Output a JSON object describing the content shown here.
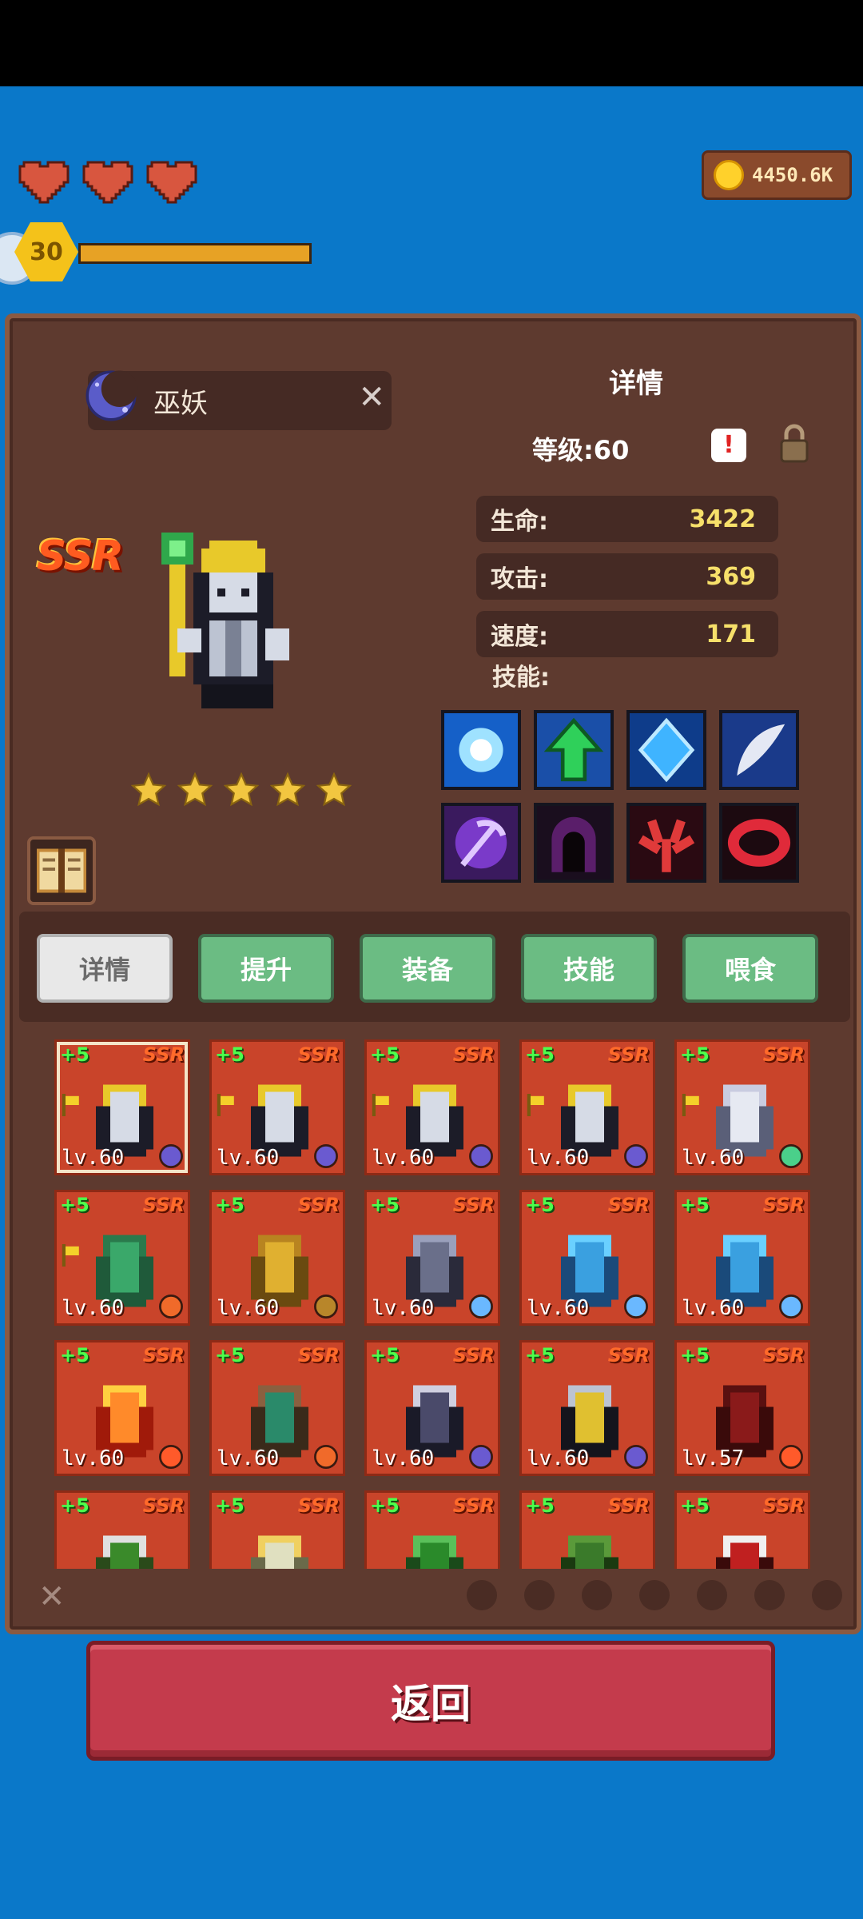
{
  "hud": {
    "hearts": 3,
    "player_level": "30",
    "xp_fraction": 1.0,
    "coins": "4450.6K"
  },
  "hero": {
    "name": "巫妖",
    "rarity": "SSR",
    "stars": 5,
    "detail_title": "详情",
    "level_label": "等级:60",
    "stats": [
      {
        "label": "生命:",
        "value": "3422"
      },
      {
        "label": "攻击:",
        "value": "369"
      },
      {
        "label": "速度:",
        "value": "171"
      }
    ],
    "skills_label": "技能:",
    "skills": [
      "light-orb-skill-icon",
      "green-arrow-up-skill-icon",
      "blue-crystal-skill-icon",
      "feather-skill-icon",
      "purple-scythe-skill-icon",
      "dark-hood-skill-icon",
      "red-claw-skill-icon",
      "red-ring-skill-icon"
    ]
  },
  "tabs": [
    {
      "label": "详情",
      "active": true
    },
    {
      "label": "提升",
      "active": false
    },
    {
      "label": "装备",
      "active": false
    },
    {
      "label": "技能",
      "active": false
    },
    {
      "label": "喂食",
      "active": false
    }
  ],
  "cards": [
    {
      "plus": "+5",
      "rarity": "SSR",
      "level": "lv.60",
      "element": "moon",
      "flag": true,
      "selected": true,
      "sprite": "lich"
    },
    {
      "plus": "+5",
      "rarity": "SSR",
      "level": "lv.60",
      "element": "moon",
      "flag": true,
      "sprite": "lich"
    },
    {
      "plus": "+5",
      "rarity": "SSR",
      "level": "lv.60",
      "element": "moon",
      "flag": true,
      "sprite": "lich"
    },
    {
      "plus": "+5",
      "rarity": "SSR",
      "level": "lv.60",
      "element": "moon",
      "flag": true,
      "sprite": "lich"
    },
    {
      "plus": "+5",
      "rarity": "SSR",
      "level": "lv.60",
      "element": "wind",
      "flag": true,
      "sprite": "white-mage"
    },
    {
      "plus": "+5",
      "rarity": "SSR",
      "level": "lv.60",
      "element": "sun",
      "flag": true,
      "sprite": "green-ghost"
    },
    {
      "plus": "+5",
      "rarity": "SSR",
      "level": "lv.60",
      "element": "earth",
      "sprite": "gold-golem"
    },
    {
      "plus": "+5",
      "rarity": "SSR",
      "level": "lv.60",
      "element": "water",
      "sprite": "gray-beast"
    },
    {
      "plus": "+5",
      "rarity": "SSR",
      "level": "lv.60",
      "element": "water",
      "sprite": "water-spirit"
    },
    {
      "plus": "+5",
      "rarity": "SSR",
      "level": "lv.60",
      "element": "water",
      "sprite": "water-spirit"
    },
    {
      "plus": "+5",
      "rarity": "SSR",
      "level": "lv.60",
      "element": "fire",
      "sprite": "fire-elemental"
    },
    {
      "plus": "+5",
      "rarity": "SSR",
      "level": "lv.60",
      "element": "sun",
      "sprite": "centaur"
    },
    {
      "plus": "+5",
      "rarity": "SSR",
      "level": "lv.60",
      "element": "moon",
      "sprite": "hooded-mage"
    },
    {
      "plus": "+5",
      "rarity": "SSR",
      "level": "lv.60",
      "element": "moon",
      "sprite": "dark-knight"
    },
    {
      "plus": "+5",
      "rarity": "SSR",
      "level": "lv.57",
      "element": "fire",
      "sprite": "red-demon"
    },
    {
      "plus": "+5",
      "rarity": "SSR",
      "level": "",
      "element": "",
      "sprite": "goblin"
    },
    {
      "plus": "+5",
      "rarity": "SSR",
      "level": "",
      "element": "",
      "sprite": "bird"
    },
    {
      "plus": "+5",
      "rarity": "SSR",
      "level": "",
      "element": "",
      "sprite": "slime"
    },
    {
      "plus": "+5",
      "rarity": "SSR",
      "level": "",
      "element": "",
      "sprite": "green-ogre"
    },
    {
      "plus": "+5",
      "rarity": "SSR",
      "level": "",
      "element": "",
      "sprite": "red-imp"
    }
  ],
  "filter_icons": [
    "fire-filter-icon",
    "earth-filter-icon",
    "water-filter-icon",
    "wind-filter-icon",
    "flame-filter-icon",
    "sun-filter-icon",
    "moon-filter-icon"
  ],
  "back_button": "返回",
  "colors": {
    "background": "#0a78c9",
    "panel": "#5e3a2f",
    "card": "#c9442a",
    "tab_green": "#6bbc83",
    "back_red": "#c43b4c"
  }
}
